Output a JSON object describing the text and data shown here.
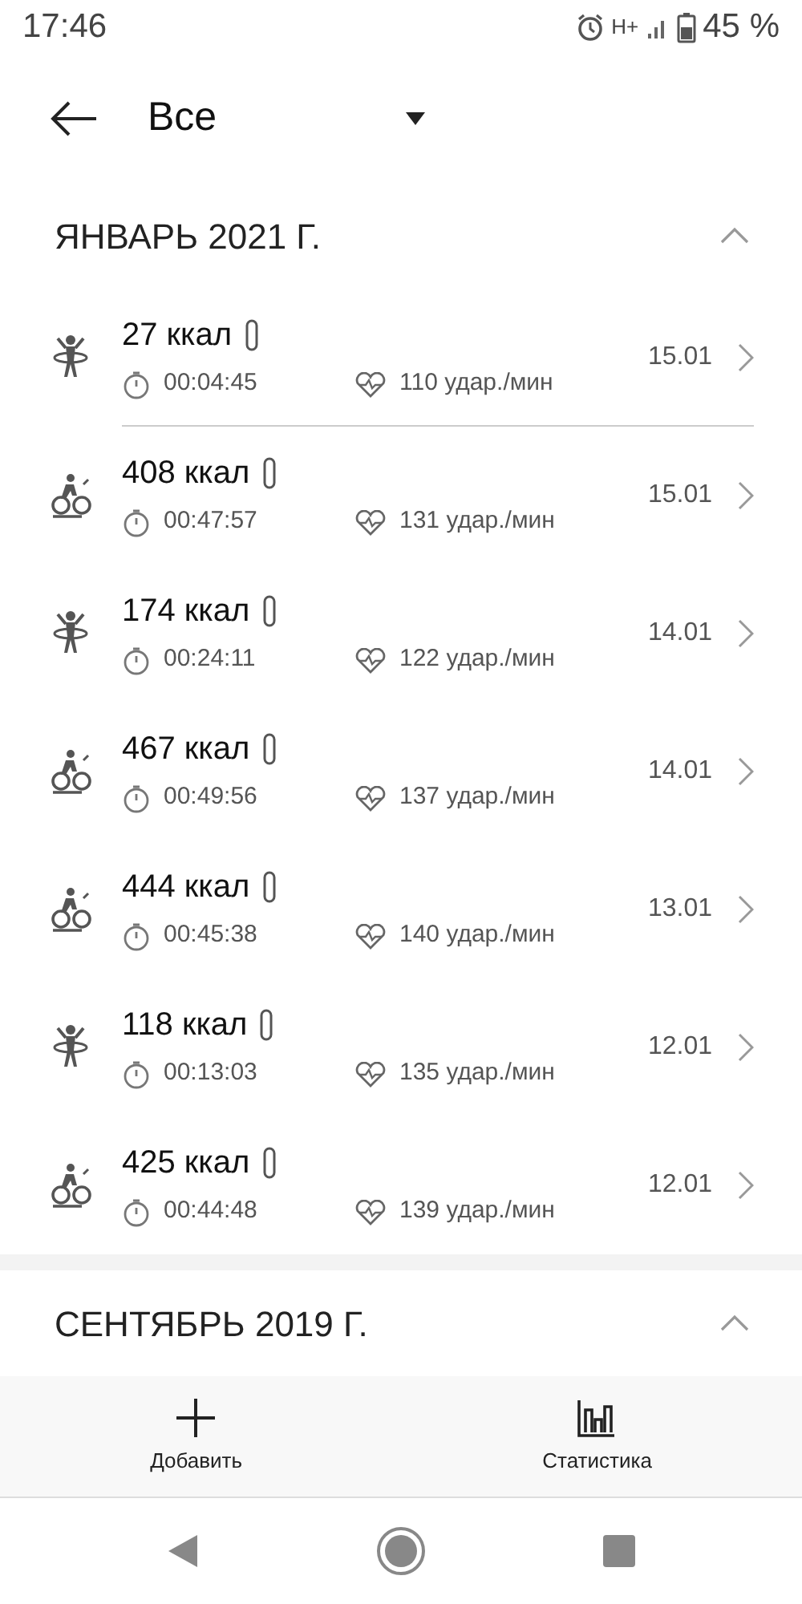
{
  "status_bar": {
    "time": "17:46",
    "network": "H+",
    "battery": "45 %"
  },
  "header": {
    "filter": "Все"
  },
  "sections": [
    {
      "title": "ЯНВАРЬ 2021 Г.",
      "expanded": true,
      "workouts": [
        {
          "kind": "hula",
          "calories": "27 ккал",
          "duration": "00:04:45",
          "heart_rate": "110 удар./мин",
          "date": "15.01",
          "divider_below": true
        },
        {
          "kind": "cycling",
          "calories": "408 ккал",
          "duration": "00:47:57",
          "heart_rate": "131 удар./мин",
          "date": "15.01",
          "divider_below": false
        },
        {
          "kind": "hula",
          "calories": "174 ккал",
          "duration": "00:24:11",
          "heart_rate": "122 удар./мин",
          "date": "14.01",
          "divider_below": false
        },
        {
          "kind": "cycling",
          "calories": "467 ккал",
          "duration": "00:49:56",
          "heart_rate": "137 удар./мин",
          "date": "14.01",
          "divider_below": false
        },
        {
          "kind": "cycling",
          "calories": "444 ккал",
          "duration": "00:45:38",
          "heart_rate": "140 удар./мин",
          "date": "13.01",
          "divider_below": false
        },
        {
          "kind": "hula",
          "calories": "118 ккал",
          "duration": "00:13:03",
          "heart_rate": "135 удар./мин",
          "date": "12.01",
          "divider_below": false
        },
        {
          "kind": "cycling",
          "calories": "425 ккал",
          "duration": "00:44:48",
          "heart_rate": "139 удар./мин",
          "date": "12.01",
          "divider_below": false
        }
      ]
    },
    {
      "title": "СЕНТЯБРЬ 2019 Г.",
      "expanded": true
    }
  ],
  "toolbar": [
    {
      "kind": "add",
      "label": "Добавить"
    },
    {
      "kind": "stats",
      "label": "Статистика"
    }
  ]
}
